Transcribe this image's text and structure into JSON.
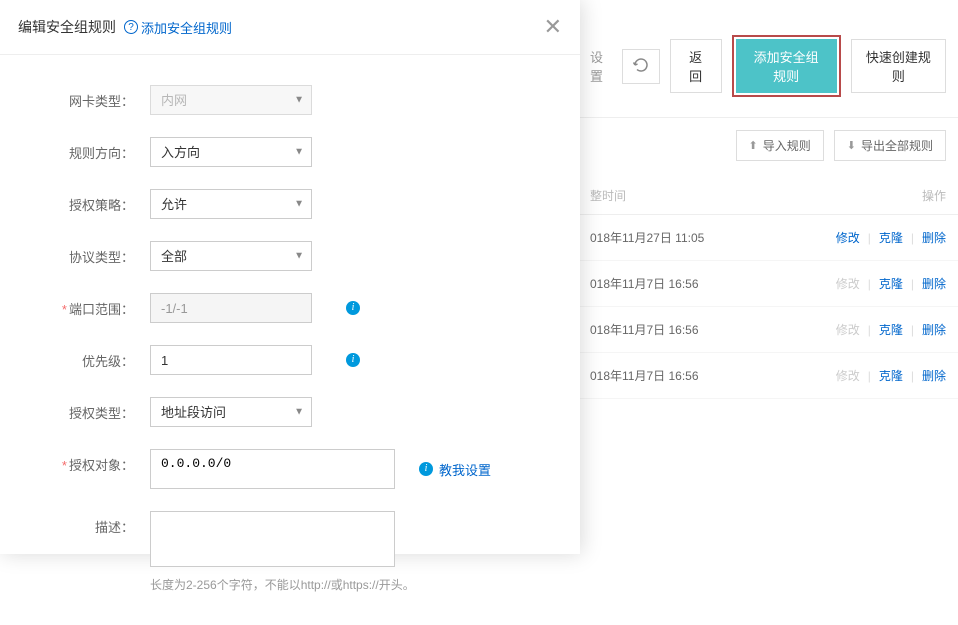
{
  "modal": {
    "title": "编辑安全组规则",
    "title_link": "添加安全组规则",
    "fields": {
      "nic_type_label": "网卡类型：",
      "nic_type_value": "内网",
      "rule_direction_label": "规则方向：",
      "rule_direction_value": "入方向",
      "auth_policy_label": "授权策略：",
      "auth_policy_value": "允许",
      "protocol_type_label": "协议类型：",
      "protocol_type_value": "全部",
      "port_range_label": "端口范围：",
      "port_range_value": "-1/-1",
      "priority_label": "优先级：",
      "priority_value": "1",
      "auth_type_label": "授权类型：",
      "auth_type_value": "地址段访问",
      "auth_object_label": "授权对象：",
      "auth_object_value": "0.0.0.0/0",
      "auth_object_help": "教我设置",
      "description_label": "描述：",
      "description_value": "",
      "description_hint": "长度为2-256个字符，不能以http://或https://开头。"
    }
  },
  "background": {
    "toolbar": {
      "settings_text": "设置",
      "back_label": "返回",
      "add_rule_label": "添加安全组规则",
      "quick_create_label": "快速创建规则"
    },
    "secondary": {
      "import_label": "导入规则",
      "export_label": "导出全部规则"
    },
    "table_header": {
      "time_col": "整时间",
      "action_col": "操作"
    },
    "rows": [
      {
        "date": "018年11月27日 11:05",
        "modify": "修改",
        "clone": "克隆",
        "delete": "删除",
        "modify_disabled": false
      },
      {
        "date": "018年11月7日 16:56",
        "modify": "修改",
        "clone": "克隆",
        "delete": "删除",
        "modify_disabled": true
      },
      {
        "date": "018年11月7日 16:56",
        "modify": "修改",
        "clone": "克隆",
        "delete": "删除",
        "modify_disabled": true
      },
      {
        "date": "018年11月7日 16:56",
        "modify": "修改",
        "clone": "克隆",
        "delete": "删除",
        "modify_disabled": true
      }
    ]
  }
}
